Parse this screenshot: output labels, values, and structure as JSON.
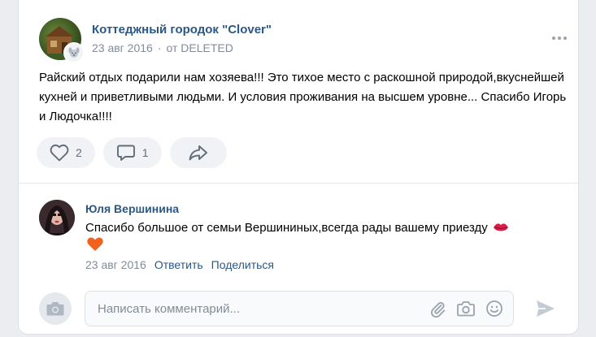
{
  "post": {
    "group_name": "Коттеджный городок \"Clover\"",
    "date": "23 авг 2016",
    "separator": "·",
    "source": "от DELETED",
    "text": "Райский отдых подарили нам хозяева!!! Это тихое место с раскошной природой,вкуснейшей кухней и приветливыми людьми. И условия проживания на высшем уровне... Спасибо Игорь и Людочка!!!!",
    "likes": "2",
    "comments": "1"
  },
  "comment": {
    "author": "Юля Вершинина",
    "text": "Спасибо большое от семьи Вершининых,всегда рады вашему приезду",
    "date": "23 авг 2016",
    "reply_label": "Ответить",
    "share_label": "Поделиться"
  },
  "compose": {
    "placeholder": "Написать комментарий..."
  },
  "icons": {
    "like": "heart-icon",
    "comment": "comment-icon",
    "share": "share-arrow-icon",
    "more": "more-dots-icon",
    "camera": "camera-icon",
    "attach": "paperclip-icon",
    "photo": "camera-icon",
    "emoji": "smile-icon",
    "send": "send-icon"
  },
  "colors": {
    "link": "#2a5885",
    "secondary": "#818c99",
    "action_bg": "#f0f2f5",
    "page_bg": "#ebedf0"
  }
}
